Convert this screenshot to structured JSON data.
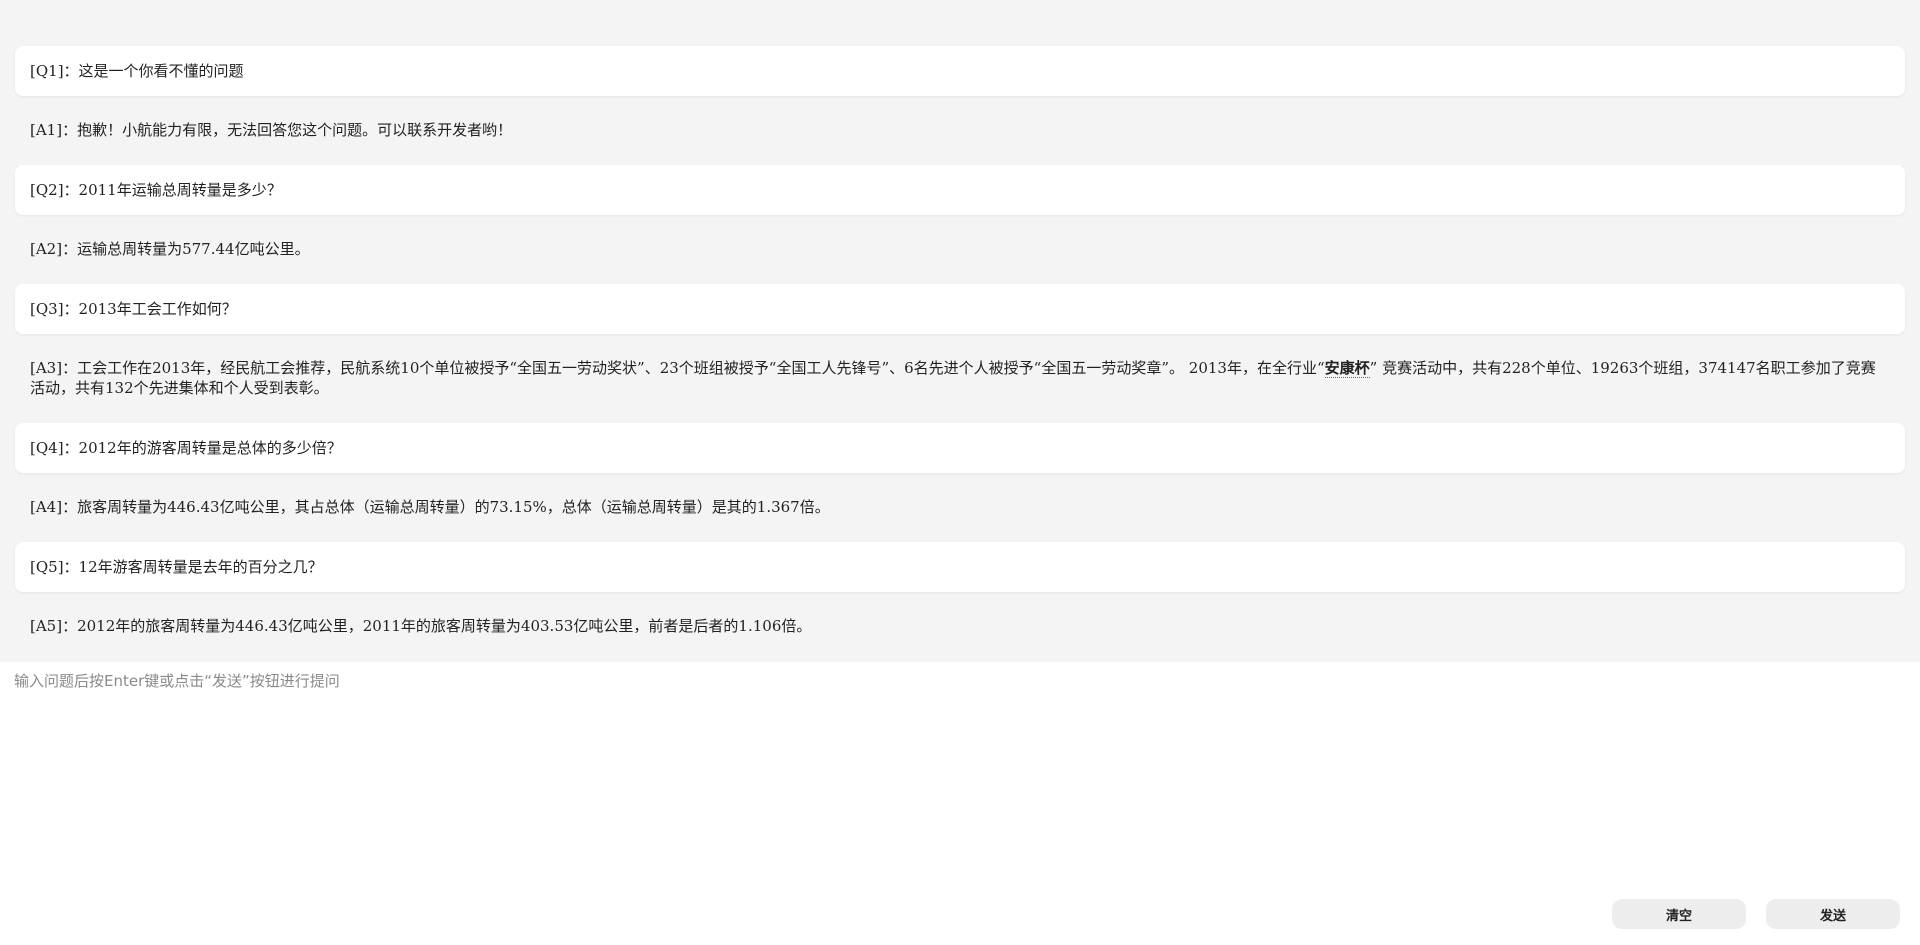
{
  "conversation": [
    {
      "q_tag": "[Q1]：",
      "q_text": "这是一个你看不懂的问题",
      "a_tag": "[A1]：",
      "a_text": "抱歉！小航能力有限，无法回答您这个问题。可以联系开发者哟！"
    },
    {
      "q_tag": "[Q2]：",
      "q_text": "2011年运输总周转量是多少？",
      "a_tag": "[A2]：",
      "a_text": "运输总周转量为577.44亿吨公里。"
    },
    {
      "q_tag": "[Q3]：",
      "q_text": "2013年工会工作如何？",
      "a_tag": "[A3]：",
      "a_before": "工会工作在2013年，经民航工会推荐，民航系统10个单位被授予“全国五一劳动奖状”、23个班组被授予“全国工人先锋号”、6名先进个人被授予“全国五一劳动奖章”。 2013年，在全行业“",
      "a_highlight": "安康杯",
      "a_after": "” 竞赛活动中，共有228个单位、19263个班组，374147名职工参加了竞赛活动，共有132个先进集体和个人受到表彰。"
    },
    {
      "q_tag": "[Q4]：",
      "q_text": "2012年的游客周转量是总体的多少倍？",
      "a_tag": "[A4]：",
      "a_text": "旅客周转量为446.43亿吨公里，其占总体（运输总周转量）的73.15%，总体（运输总周转量）是其的1.367倍。"
    },
    {
      "q_tag": "[Q5]：",
      "q_text": "12年游客周转量是去年的百分之几？",
      "a_tag": "[A5]：",
      "a_text": "2012年的旅客周转量为446.43亿吨公里，2011年的旅客周转量为403.53亿吨公里，前者是后者的1.106倍。"
    }
  ],
  "input": {
    "placeholder": "输入问题后按Enter键或点击“发送”按钮进行提问",
    "value": ""
  },
  "buttons": {
    "clear_label": "清空",
    "send_label": "发送"
  },
  "colors": {
    "chat_background": "#f4f4f4",
    "question_card": "#ffffff",
    "button_background": "#ededed"
  }
}
